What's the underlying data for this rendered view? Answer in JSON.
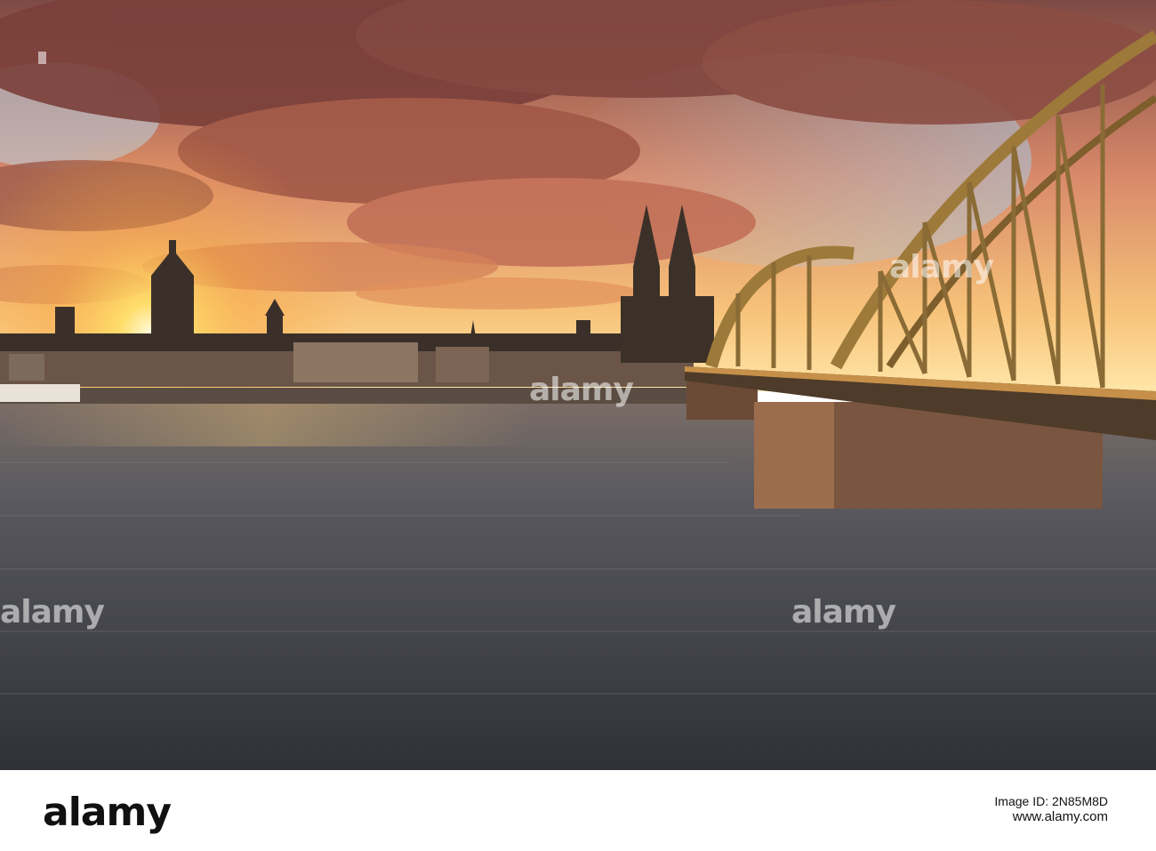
{
  "image": {
    "description_colors": {
      "sky_top": "#8a4b3c",
      "sky_glow": "#ffd27a",
      "cloud": "#b36455",
      "water": "#4e5157",
      "bridge": "#8a6b35",
      "skyline": "#3a3028"
    }
  },
  "watermark": {
    "text": "alamy"
  },
  "footer": {
    "logo": "alamy",
    "image_id_label": "Image ID: 2N85M8D",
    "url": "www.alamy.com"
  }
}
